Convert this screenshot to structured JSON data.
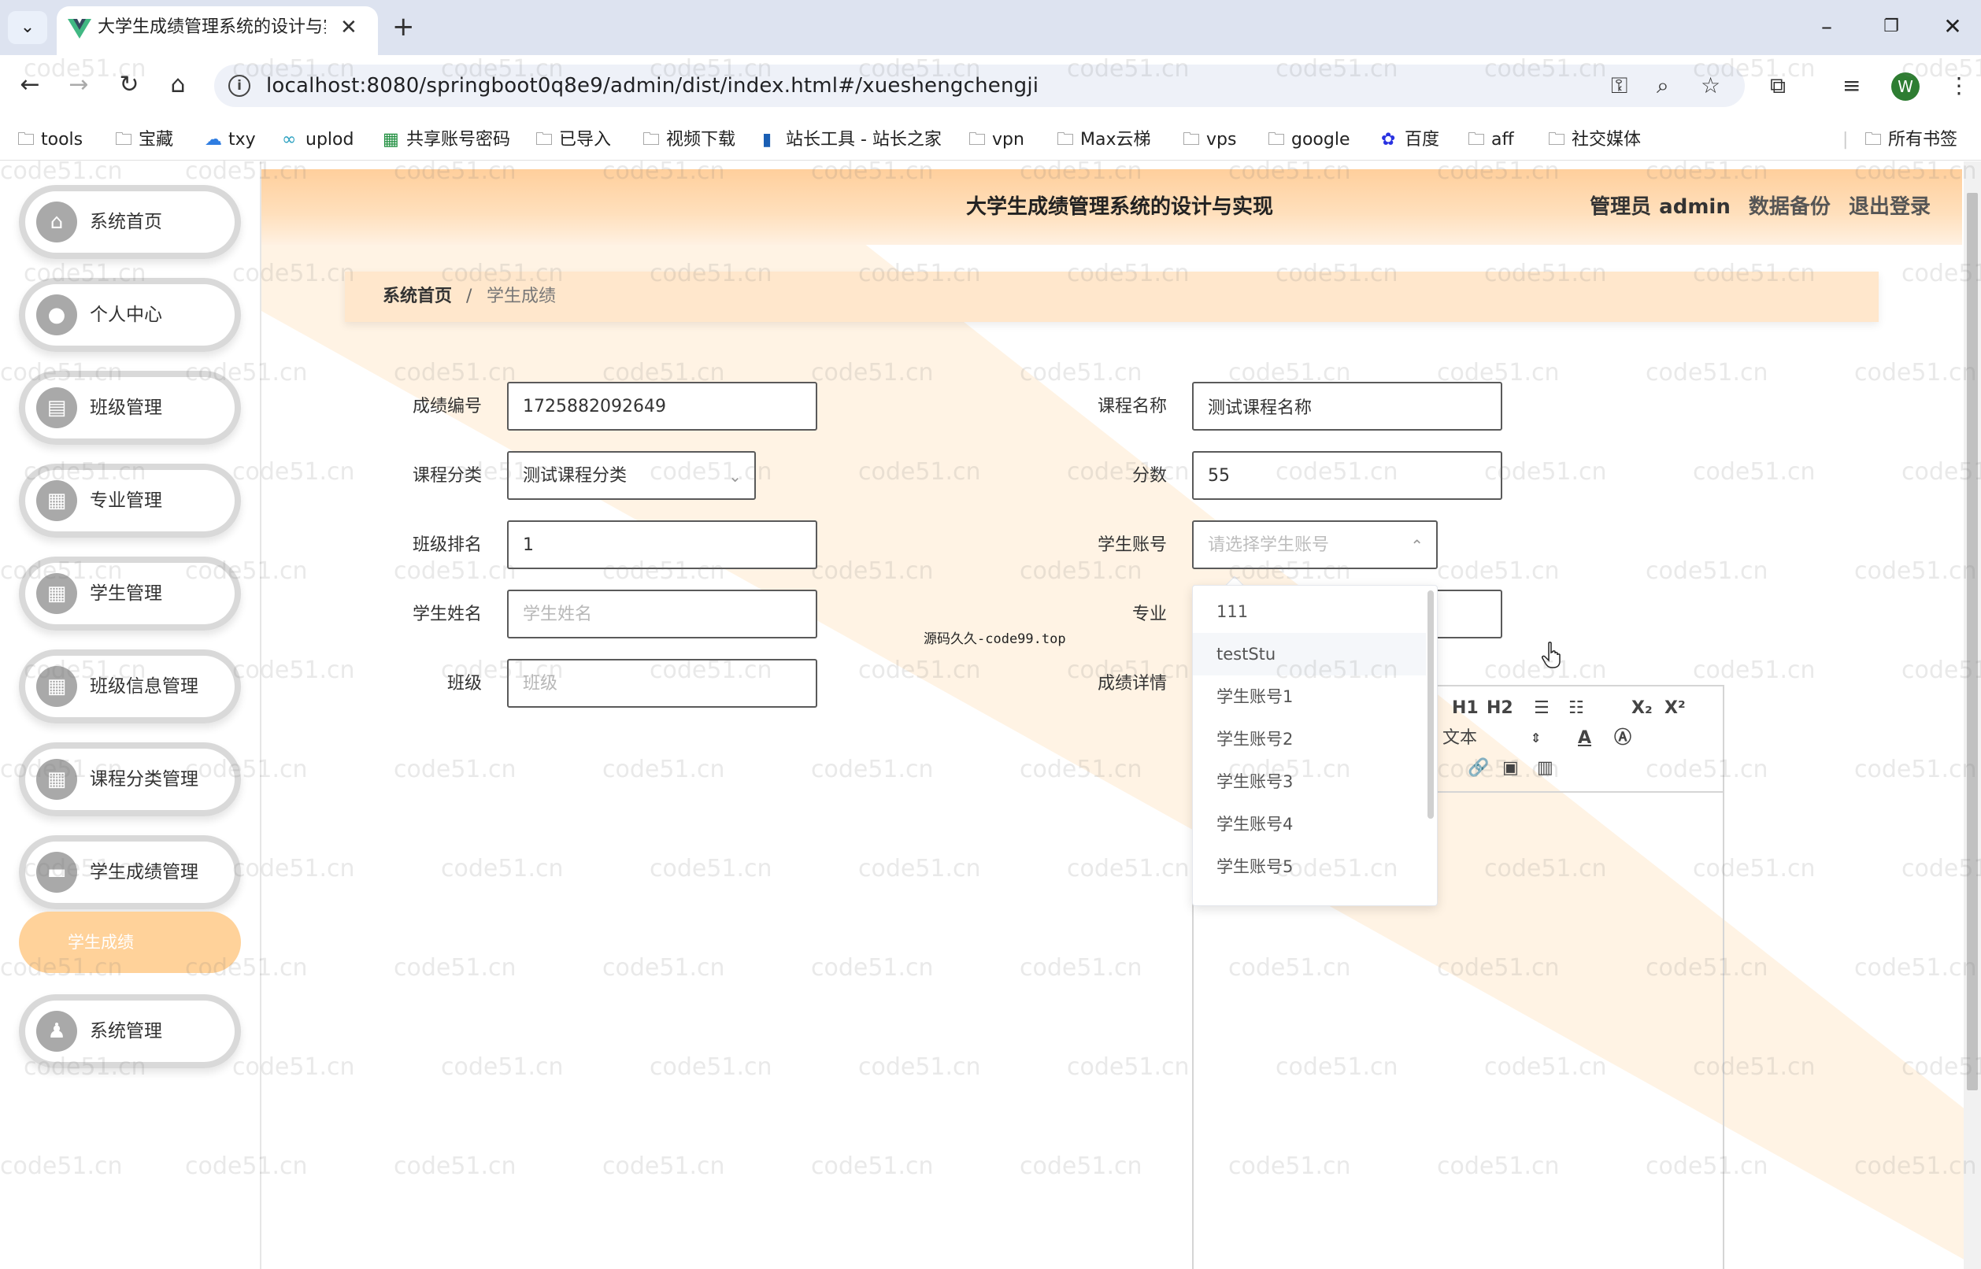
{
  "browser": {
    "tab_title": "大学生成绩管理系统的设计与实",
    "url": "localhost:8080/springboot0q8e9/admin/dist/index.html#/xueshengchengji",
    "profile_initial": "W",
    "bookmarks": [
      "tools",
      "宝藏",
      "txy",
      "uplod",
      "共享账号密码",
      "已导入",
      "视频下载",
      "站长工具 - 站长之家",
      "vpn",
      "Max云梯",
      "vps",
      "google",
      "百度",
      "aff",
      "社交媒体"
    ],
    "all_bookmarks": "所有书签"
  },
  "app": {
    "title": "大学生成绩管理系统的设计与实现",
    "user_role": "管理员",
    "user_name": "admin",
    "backup_link": "数据备份",
    "logout_link": "退出登录"
  },
  "sidebar": {
    "items": [
      {
        "label": "系统首页",
        "icon": "home-icon"
      },
      {
        "label": "个人中心",
        "icon": "user-icon"
      },
      {
        "label": "班级管理",
        "icon": "clipboard-icon"
      },
      {
        "label": "专业管理",
        "icon": "grid-icon"
      },
      {
        "label": "学生管理",
        "icon": "grid-icon"
      },
      {
        "label": "班级信息管理",
        "icon": "grid-icon"
      },
      {
        "label": "课程分类管理",
        "icon": "grid-icon"
      },
      {
        "label": "学生成绩管理",
        "icon": "folder-icon"
      },
      {
        "label": "系统管理",
        "icon": "person-icon"
      }
    ],
    "active_sub": "学生成绩"
  },
  "breadcrumb": {
    "home": "系统首页",
    "separator": "/",
    "current": "学生成绩"
  },
  "form": {
    "score_id": {
      "label": "成绩编号",
      "value": "1725882092649"
    },
    "course_name": {
      "label": "课程名称",
      "value": "测试课程名称"
    },
    "course_category": {
      "label": "课程分类",
      "value": "测试课程分类"
    },
    "score": {
      "label": "分数",
      "value": "55"
    },
    "class_rank": {
      "label": "班级排名",
      "value": "1"
    },
    "student_account": {
      "label": "学生账号",
      "placeholder": "请选择学生账号"
    },
    "student_name": {
      "label": "学生姓名",
      "placeholder": "学生姓名"
    },
    "major": {
      "label": "专业"
    },
    "class": {
      "label": "班级",
      "placeholder": "班级"
    },
    "detail": {
      "label": "成绩详情"
    }
  },
  "editor": {
    "h1": "H1",
    "h2": "H2",
    "sub": "X₂",
    "sup": "X²",
    "text_style": "文本"
  },
  "dropdown": {
    "options": [
      "111",
      "testStu",
      "学生账号1",
      "学生账号2",
      "学生账号3",
      "学生账号4",
      "学生账号5"
    ],
    "hovered": "testStu"
  },
  "overlay_text": "源码久久-code99.top",
  "watermark": "code51.cn",
  "colors": {
    "accent": "#ffd29a",
    "header_top": "#ffcf9c",
    "breadcrumb_bg": "#ffe7cc"
  }
}
